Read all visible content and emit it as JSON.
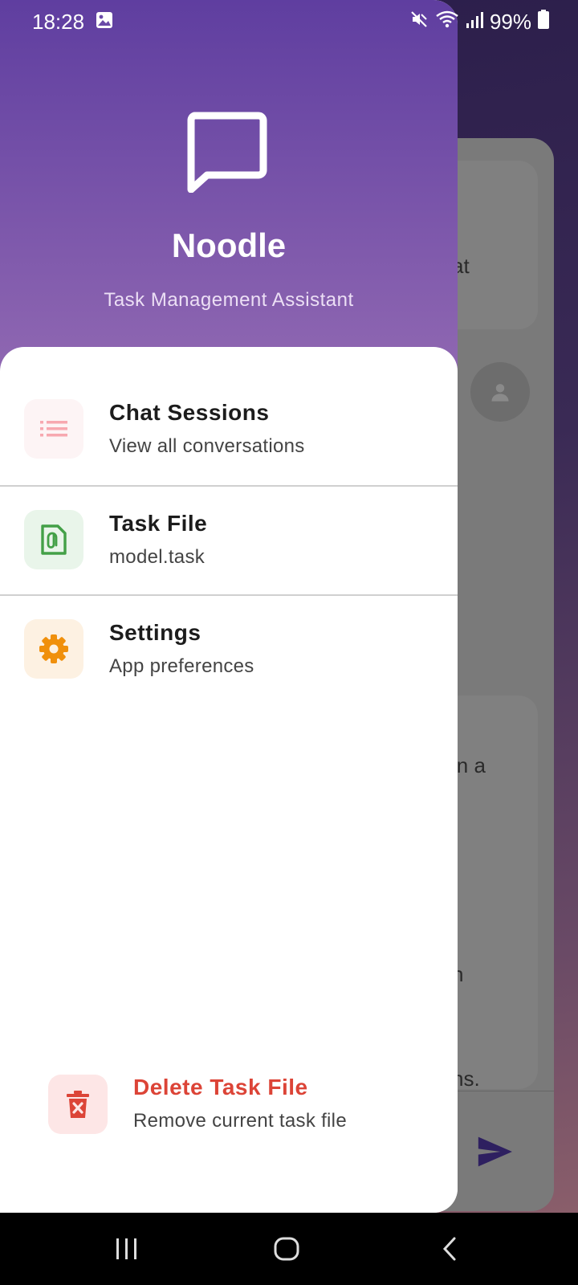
{
  "status_bar": {
    "time": "18:28",
    "battery": "99%",
    "icons": [
      "image-icon",
      "mute-icon",
      "wifi-icon",
      "signal-icon",
      "battery-icon"
    ]
  },
  "background": {
    "snippets": [
      "at",
      "in a",
      "n",
      "ns."
    ]
  },
  "drawer": {
    "header": {
      "icon": "chat-bubble-icon",
      "app_name": "Noodle",
      "subtitle": "Task Management Assistant",
      "gradient": [
        "#5f3ea0",
        "#9068b2"
      ]
    },
    "items": [
      {
        "title": "Chat Sessions",
        "subtitle": "View all conversations",
        "icon": "list-icon",
        "color": "#f7a8b0"
      },
      {
        "title": "Task File",
        "subtitle": "model.task",
        "icon": "file-icon",
        "color": "#43a047"
      },
      {
        "title": "Settings",
        "subtitle": "App preferences",
        "icon": "gear-icon",
        "color": "#f0900c"
      }
    ],
    "danger_item": {
      "title": "Delete Task File",
      "subtitle": "Remove current task file",
      "icon": "delete-icon",
      "color": "#dc4437"
    }
  },
  "nav_bar": {
    "buttons": [
      "recents-button",
      "home-button",
      "back-button"
    ]
  }
}
